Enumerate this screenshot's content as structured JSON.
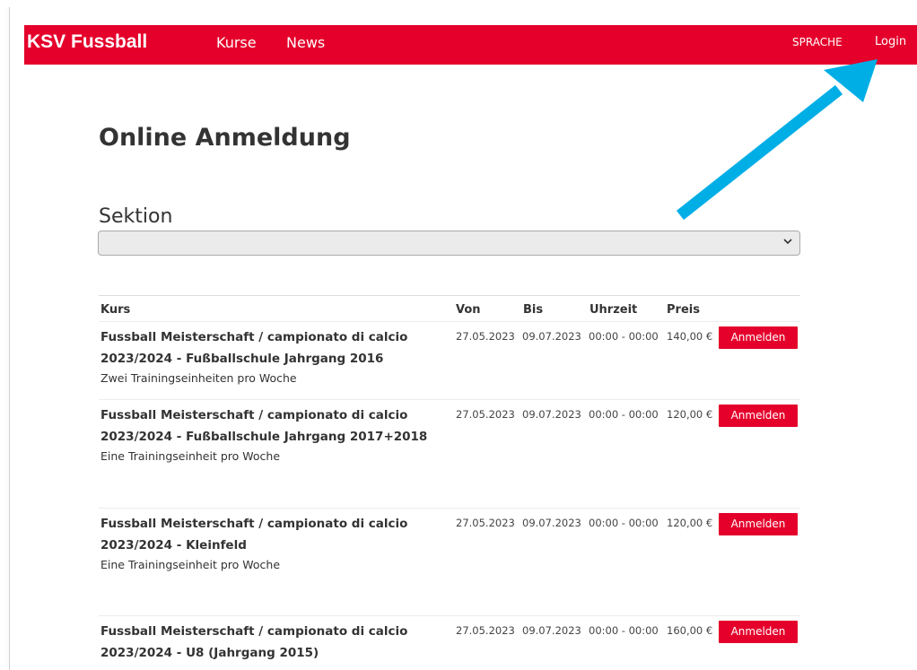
{
  "navbar": {
    "brand": "KSV Fussball",
    "links": [
      "Kurse",
      "News"
    ],
    "language_label": "SPRACHE",
    "login_label": "Login",
    "color": "#e4002b"
  },
  "page": {
    "title": "Online Anmeldung",
    "section_label": "Sektion",
    "section_select_value": ""
  },
  "table": {
    "headers": {
      "kurs": "Kurs",
      "von": "Von",
      "bis": "Bis",
      "uhrzeit": "Uhrzeit",
      "preis": "Preis"
    },
    "rows": [
      {
        "title": "Fussball Meisterschaft / campionato di calcio 2023/2024 - Fußballschule Jahrgang 2016",
        "description": "Zwei Trainingseinheiten pro Woche",
        "von": "27.05.2023",
        "bis": "09.07.2023",
        "uhrzeit": "00:00 - 00:00",
        "preis": "140,00 €",
        "button": "Anmelden"
      },
      {
        "title": "Fussball Meisterschaft / campionato di calcio 2023/2024 - Fußballschule Jahrgang 2017+2018",
        "description": "Eine Trainingseinheit pro Woche",
        "von": "27.05.2023",
        "bis": "09.07.2023",
        "uhrzeit": "00:00 - 00:00",
        "preis": "120,00 €",
        "button": "Anmelden"
      },
      {
        "title": "Fussball Meisterschaft / campionato di calcio 2023/2024 - Kleinfeld",
        "description": "Eine Trainingseinheit pro Woche",
        "von": "27.05.2023",
        "bis": "09.07.2023",
        "uhrzeit": "00:00 - 00:00",
        "preis": "120,00 €",
        "button": "Anmelden"
      },
      {
        "title": "Fussball Meisterschaft / campionato di calcio 2023/2024 - U8 (Jahrgang 2015)",
        "description": "",
        "von": "27.05.2023",
        "bis": "09.07.2023",
        "uhrzeit": "00:00 - 00:00",
        "preis": "160,00 €",
        "button": "Anmelden"
      }
    ]
  },
  "annotation": {
    "arrow_color": "#00aee6",
    "arrow_points_to": "login"
  }
}
